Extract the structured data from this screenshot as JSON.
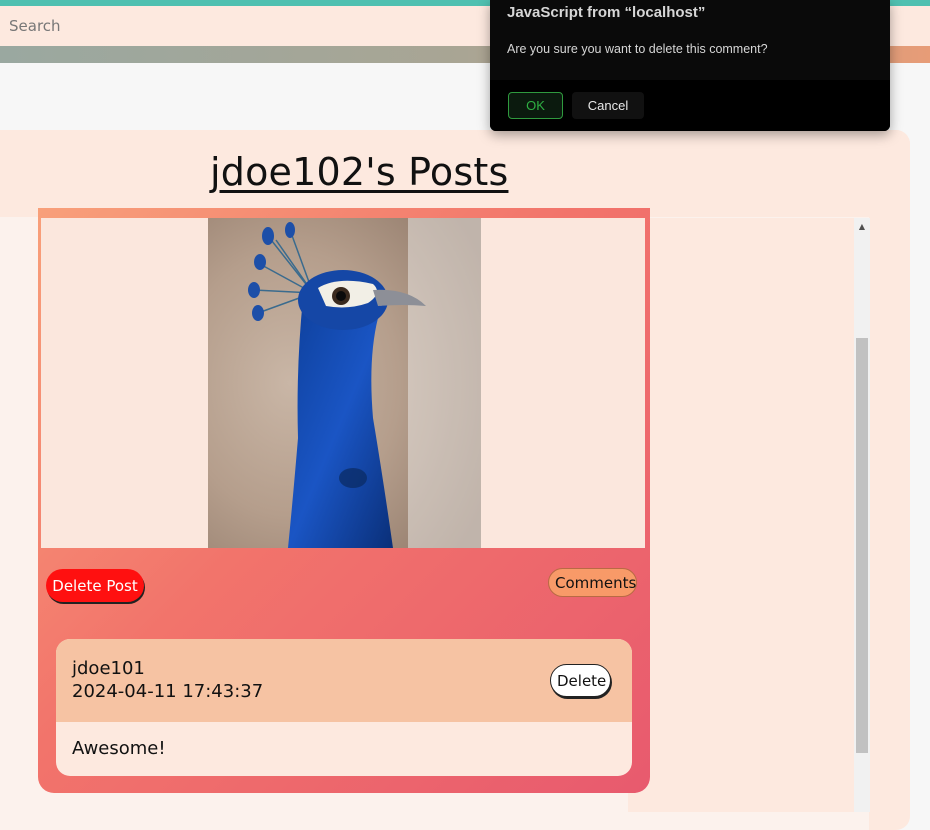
{
  "header": {
    "search_placeholder": "Search"
  },
  "page": {
    "title": "jdoe102's Posts"
  },
  "post": {
    "delete_label": "Delete Post",
    "comments_label": "Comments",
    "image_subject": "peacock"
  },
  "comment": {
    "username": "jdoe101",
    "date": "2024-04-11 17:43:37",
    "delete_label": "Delete",
    "text": "Awesome!"
  },
  "dialog": {
    "title": "JavaScript from “localhost”",
    "message": "Are you sure you want to delete this comment?",
    "ok_label": "OK",
    "cancel_label": "Cancel"
  },
  "colors": {
    "accent_teal": "#4fc0b0",
    "delete_red": "#ff1010",
    "ok_green": "#2fb043"
  }
}
